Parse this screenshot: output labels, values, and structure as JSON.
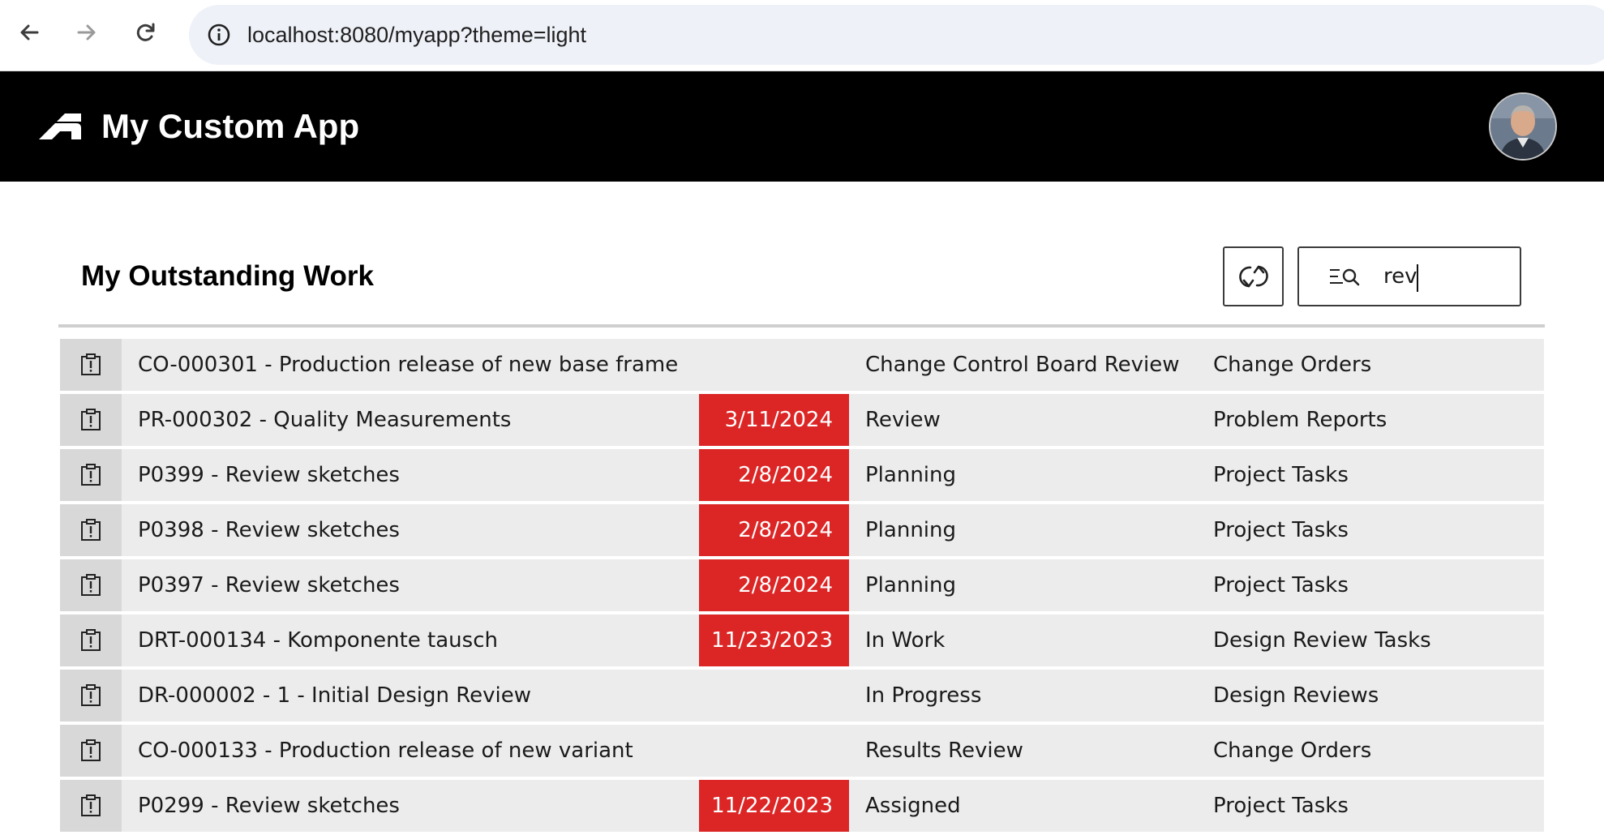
{
  "browser": {
    "url": "localhost:8080/myapp?theme=light"
  },
  "app": {
    "title": "My Custom App"
  },
  "panel": {
    "title": "My Outstanding Work",
    "search_value": "rev"
  },
  "colors": {
    "header_bg": "#000000",
    "overdue": "#dc2626",
    "row_bg": "#ececec",
    "icon_cell_bg": "#d8d8d8"
  },
  "rows": [
    {
      "title": "CO-000301 - Production release of new base frame",
      "due": "",
      "state": "Change Control Board Review",
      "workspace": "Change Orders"
    },
    {
      "title": "PR-000302 - Quality Measurements",
      "due": "3/11/2024",
      "state": "Review",
      "workspace": "Problem Reports"
    },
    {
      "title": "P0399 - Review sketches",
      "due": "2/8/2024",
      "state": "Planning",
      "workspace": "Project Tasks"
    },
    {
      "title": "P0398 - Review sketches",
      "due": "2/8/2024",
      "state": "Planning",
      "workspace": "Project Tasks"
    },
    {
      "title": "P0397 - Review sketches",
      "due": "2/8/2024",
      "state": "Planning",
      "workspace": "Project Tasks"
    },
    {
      "title": "DRT-000134 - Komponente tausch",
      "due": "11/23/2023",
      "state": "In Work",
      "workspace": "Design Review Tasks"
    },
    {
      "title": "DR-000002 - 1 - Initial Design Review",
      "due": "",
      "state": "In Progress",
      "workspace": "Design Reviews"
    },
    {
      "title": "CO-000133 - Production release of new variant",
      "due": "",
      "state": "Results Review",
      "workspace": "Change Orders"
    },
    {
      "title": "P0299 - Review sketches",
      "due": "11/22/2023",
      "state": "Assigned",
      "workspace": "Project Tasks"
    }
  ]
}
